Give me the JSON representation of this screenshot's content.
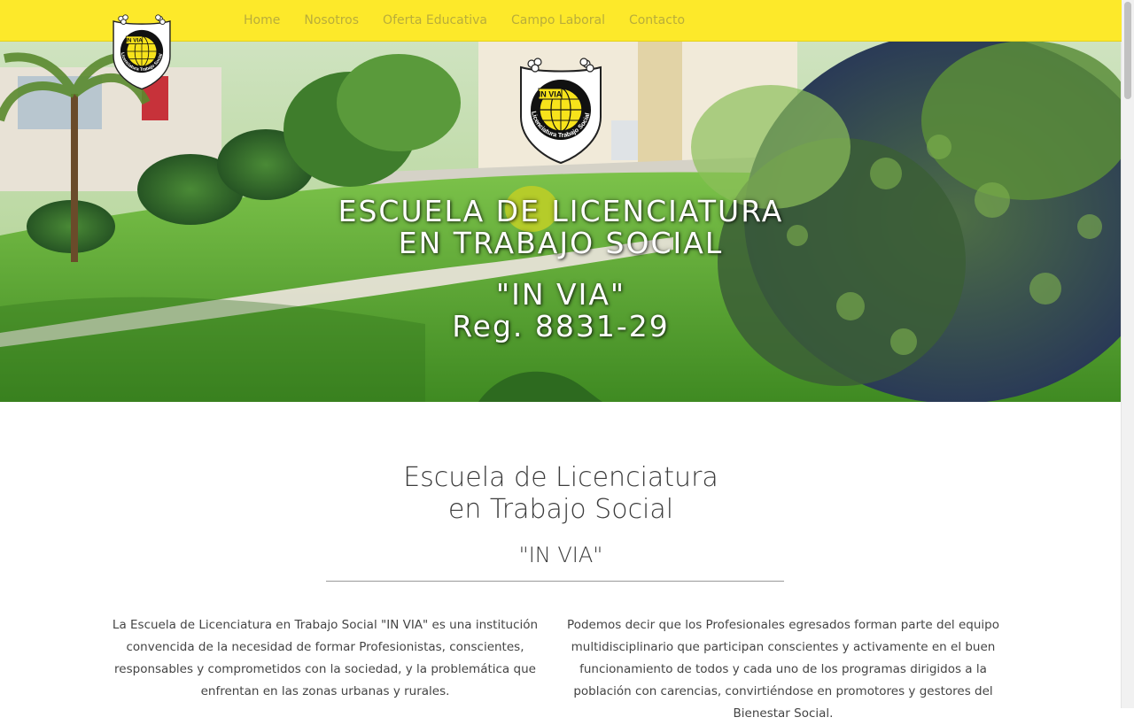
{
  "nav": {
    "items": [
      {
        "label": "Home"
      },
      {
        "label": "Nosotros"
      },
      {
        "label": "Oferta Educativa"
      },
      {
        "label": "Campo Laboral"
      },
      {
        "label": "Contacto"
      }
    ]
  },
  "logo": {
    "text_badge": "IN VIA",
    "text_ring": "Licenciatura Trabajo Social"
  },
  "hero": {
    "line1": "ESCUELA DE LICENCIATURA",
    "line2": "EN TRABAJO SOCIAL",
    "line3": "\"IN VIA\"",
    "line4": "Reg. 8831-29"
  },
  "intro": {
    "title_line1": "Escuela de Licenciatura",
    "title_line2": "en Trabajo Social",
    "subtitle": "\"IN VIA\"",
    "paragraph_left": "La Escuela de Licenciatura en Trabajo Social \"IN VIA\" es una institución convencida de la necesidad de formar Profesionistas, conscientes, responsables y comprometidos con la sociedad, y la problemática que enfrentan en las zonas urbanas y rurales.",
    "paragraph_right": "Podemos decir que los Profesionales egresados forman parte del equipo multidisciplinario que participan conscientes y activamente en el buen funcionamiento de todos y cada uno de los programas dirigidos a la población con carencias, convirtiéndose en promotores y gestores del Bienestar Social."
  },
  "colors": {
    "nav_bg": "#fde92a",
    "nav_text": "#b9ad3a",
    "logo_yellow": "#f7e31b",
    "logo_black": "#111111"
  }
}
